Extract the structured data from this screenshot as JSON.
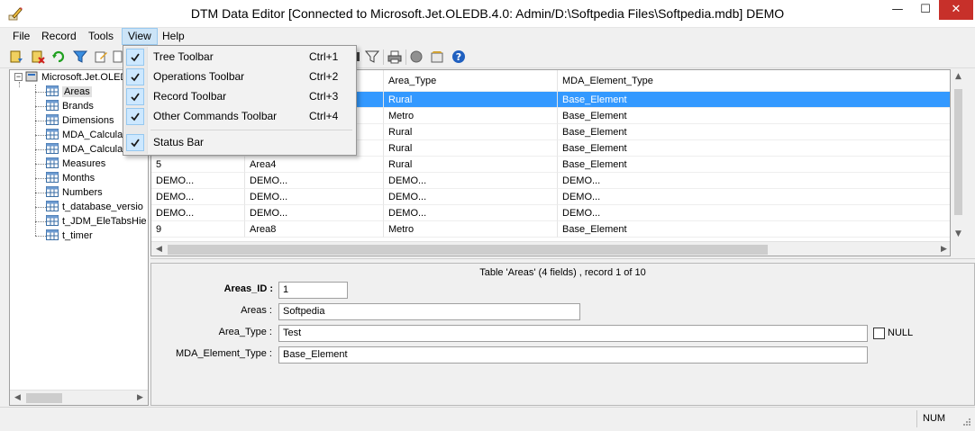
{
  "window": {
    "title": "DTM Data Editor [Connected to Microsoft.Jet.OLEDB.4.0: Admin/D:\\Softpedia Files\\Softpedia.mdb] DEMO",
    "minimize": "—",
    "maximize": "☐",
    "close": "✕"
  },
  "menu": {
    "items": [
      {
        "label": "File"
      },
      {
        "label": "Record"
      },
      {
        "label": "Tools"
      },
      {
        "label": "View"
      },
      {
        "label": "Help"
      }
    ]
  },
  "view_menu": {
    "items": [
      {
        "label": "Tree Toolbar",
        "shortcut": "Ctrl+1",
        "checked": true
      },
      {
        "label": "Operations Toolbar",
        "shortcut": "Ctrl+2",
        "checked": true
      },
      {
        "label": "Record Toolbar",
        "shortcut": "Ctrl+3",
        "checked": true
      },
      {
        "label": "Other Commands Toolbar",
        "shortcut": "Ctrl+4",
        "checked": true
      },
      {
        "label": "Status Bar",
        "shortcut": "",
        "checked": true
      }
    ]
  },
  "tree": {
    "root": "Microsoft.Jet.OLEDB",
    "tables": [
      "Areas",
      "Brands",
      "Dimensions",
      "MDA_Calcula",
      "MDA_Calcula",
      "Measures",
      "Months",
      "Numbers",
      "t_database_versio",
      "t_JDM_EleTabsHie",
      "t_timer"
    ],
    "selected": "Areas"
  },
  "grid": {
    "columns": [
      "",
      "",
      "Area_Type",
      "MDA_Element_Type"
    ],
    "rows": [
      [
        "",
        "",
        "Rural",
        "Base_Element"
      ],
      [
        "",
        "",
        "Metro",
        "Base_Element"
      ],
      [
        "",
        "",
        "Rural",
        "Base_Element"
      ],
      [
        "",
        "",
        "Rural",
        "Base_Element"
      ],
      [
        "5",
        "Area4",
        "Rural",
        "Base_Element"
      ],
      [
        "DEMO...",
        "DEMO...",
        "DEMO...",
        "DEMO..."
      ],
      [
        "DEMO...",
        "DEMO...",
        "DEMO...",
        "DEMO..."
      ],
      [
        "DEMO...",
        "DEMO...",
        "DEMO...",
        "DEMO..."
      ],
      [
        "9",
        "Area8",
        "Metro",
        "Base_Element"
      ]
    ],
    "selected_row": 0
  },
  "form": {
    "caption": "Table 'Areas' (4 fields) , record 1 of 10",
    "fields": [
      {
        "label": "Areas_ID :",
        "value": "1",
        "bold": true
      },
      {
        "label": "Areas :",
        "value": "Softpedia",
        "bold": false
      },
      {
        "label": "Area_Type :",
        "value": "Test",
        "bold": false
      },
      {
        "label": "MDA_Element_Type :",
        "value": "Base_Element",
        "bold": false
      }
    ],
    "null_label": "NULL"
  },
  "status": {
    "num": "NUM"
  },
  "colors": {
    "selection": "#3399ff",
    "menu_highlight": "#cce4f7",
    "close_button": "#c7302a"
  }
}
